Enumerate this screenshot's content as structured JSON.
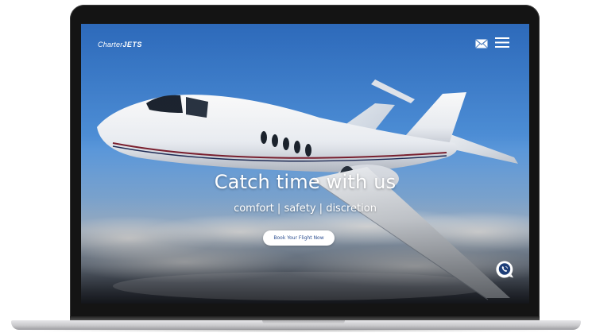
{
  "header": {
    "logo_prefix": "Charter",
    "logo_suffix": "JETS",
    "mail_icon": "envelope-icon",
    "menu_icon": "hamburger-menu-icon"
  },
  "hero": {
    "title": "Catch time with us",
    "tagline": "comfort | safety | discretion",
    "cta_label": "Book Your Flight Now",
    "call_icon": "phone-chat-icon"
  },
  "colors": {
    "sky_top": "#2f6fc4",
    "sky_mid": "#86b3e3",
    "cta_text": "#2a4d8f",
    "accent_white": "#ffffff"
  }
}
